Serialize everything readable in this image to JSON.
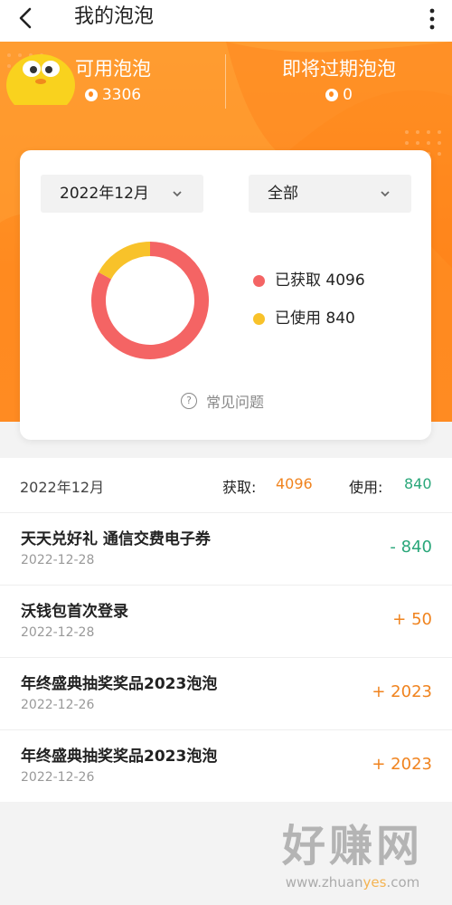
{
  "header": {
    "title": "我的泡泡"
  },
  "stats": {
    "available": {
      "label": "可用泡泡",
      "value": "3306"
    },
    "expiring": {
      "label": "即将过期泡泡",
      "value": "0"
    }
  },
  "card": {
    "month_select": "2022年12月",
    "type_select": "全部",
    "legend": [
      {
        "label": "已获取 4096",
        "color": "#f46464"
      },
      {
        "label": "已使用 840",
        "color": "#f8c22a"
      }
    ],
    "faq": "常见问题"
  },
  "chart_data": {
    "type": "pie",
    "categories": [
      "已获取",
      "已使用"
    ],
    "values": [
      4096,
      840
    ],
    "colors": [
      "#f46464",
      "#f8c22a"
    ]
  },
  "summary": {
    "month": "2022年12月",
    "gain_label": "获取:",
    "gain_value": "4096",
    "use_label": "使用:",
    "use_value": "840"
  },
  "records": [
    {
      "name": "天天兑好礼 通信交费电子券",
      "date": "2022-12-28",
      "amount": "- 840",
      "color": "#2aa77a"
    },
    {
      "name": "沃钱包首次登录",
      "date": "2022-12-28",
      "amount": "+ 50",
      "color": "#f0831e"
    },
    {
      "name": "年终盛典抽奖奖品2023泡泡",
      "date": "2022-12-26",
      "amount": "+ 2023",
      "color": "#f0831e"
    },
    {
      "name": "年终盛典抽奖奖品2023泡泡",
      "date": "2022-12-26",
      "amount": "+ 2023",
      "color": "#f0831e"
    }
  ],
  "watermark": {
    "big": "好赚网",
    "small_a": "www.zhuan",
    "small_b": "yes",
    "small_c": ".com"
  }
}
